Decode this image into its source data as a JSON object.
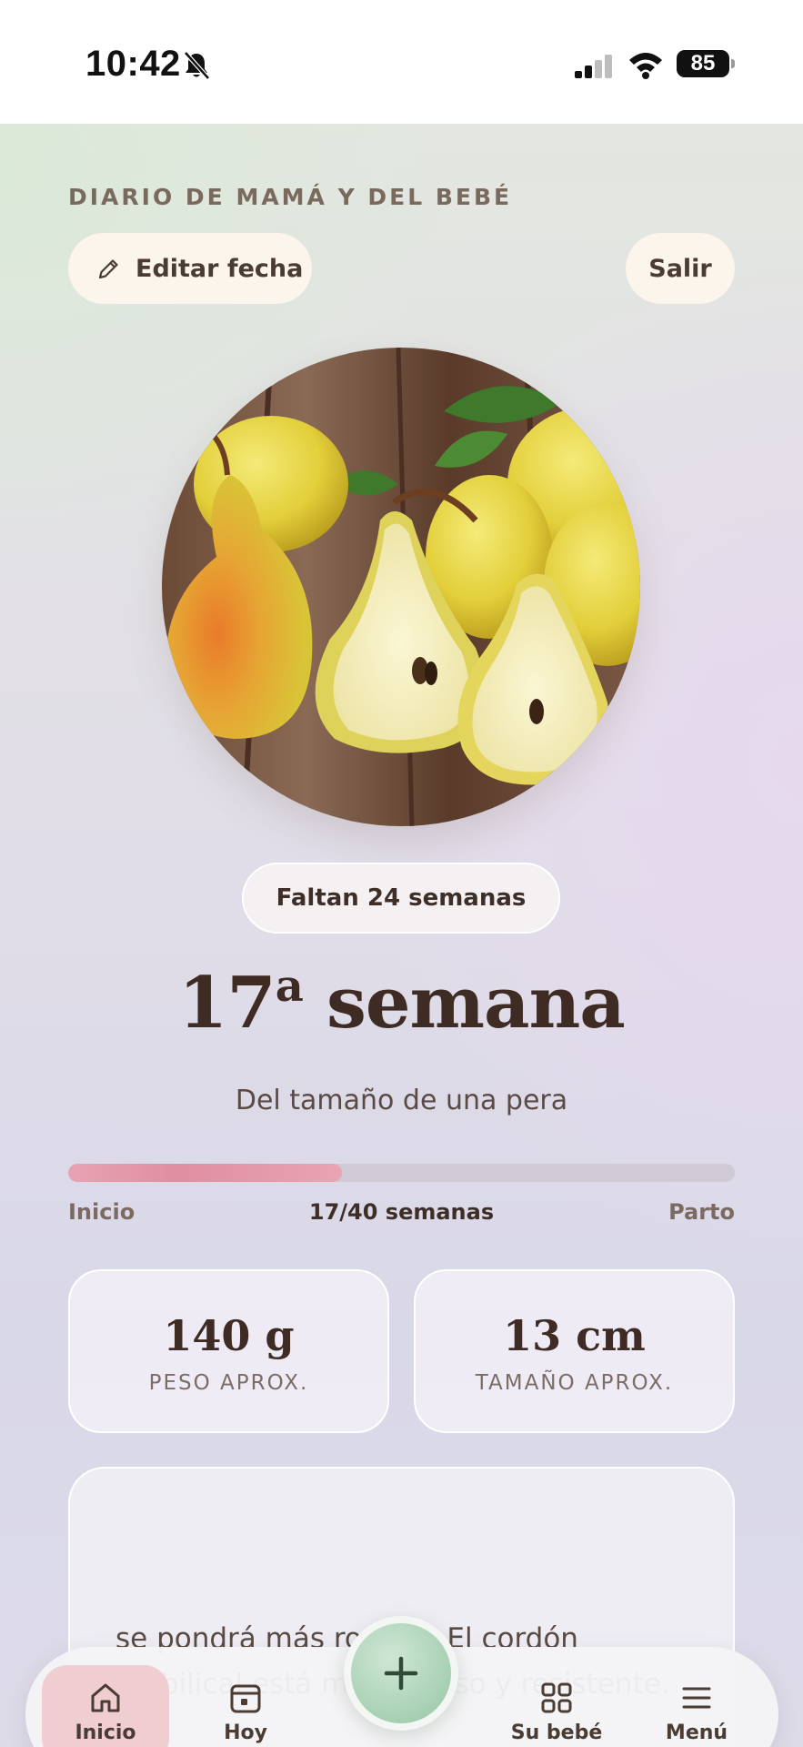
{
  "status_bar": {
    "time": "10:42",
    "battery": "85"
  },
  "header": {
    "journal_title": "DIARIO DE MAMÁ Y DEL BEBÉ",
    "edit_date_label": "Editar fecha",
    "exit_label": "Salir"
  },
  "hero": {
    "image": "pears-photo",
    "remaining": "Faltan 24 semanas",
    "week_number": "17",
    "week_ordinal": "a",
    "week_word": "semana",
    "size_comparison": "Del tamaño de una pera"
  },
  "progress": {
    "start_label": "Inicio",
    "end_label": "Parto",
    "current_label": "17/40 semanas",
    "fraction": 0.41
  },
  "stats": [
    {
      "value": "140 g",
      "label": "PESO APROX."
    },
    {
      "value": "13 cm",
      "label": "TAMAÑO APROX."
    }
  ],
  "info": {
    "text": "se pondrá más rosada. El cordón umbilical está más grueso y resistente."
  },
  "nav": {
    "home": "Inicio",
    "today": "Hoy",
    "baby": "Su bebé",
    "menu": "Menú",
    "add_icon": "plus-icon"
  },
  "colors": {
    "accent_pink": "#e08ea2",
    "accent_green": "#a7d0b3",
    "text_dark": "#3d2b24"
  }
}
